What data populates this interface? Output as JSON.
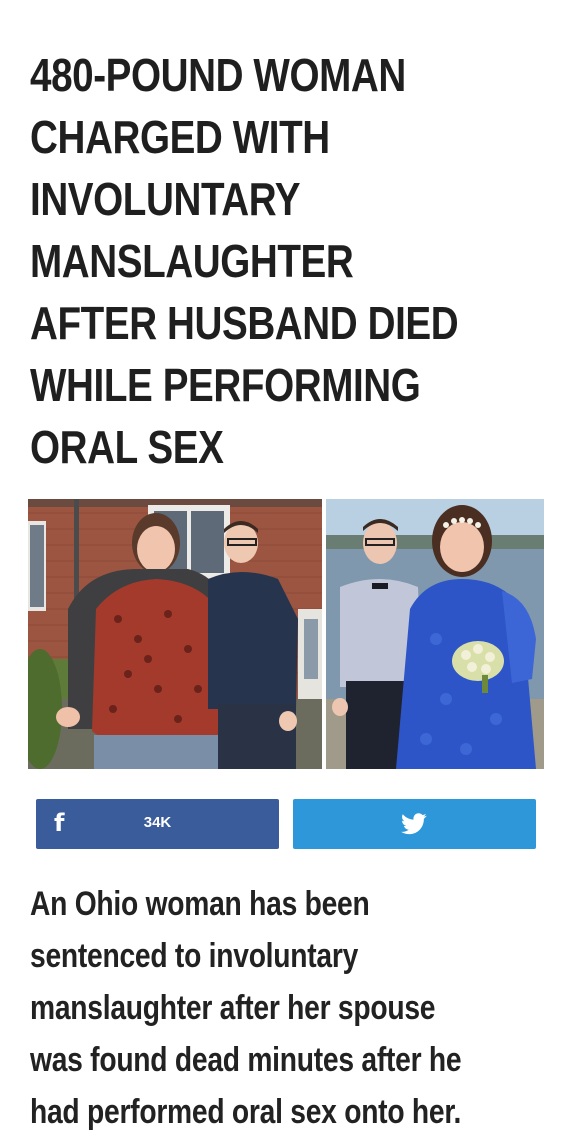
{
  "article": {
    "headline_lines": [
      "480-POUND WOMAN",
      "CHARGED WITH",
      "INVOLUNTARY",
      "MANSLAUGHTER",
      "AFTER HUSBAND DIED",
      "WHILE PERFORMING",
      "ORAL SEX"
    ],
    "body_lines": [
      "An Ohio woman has been",
      "sentenced to involuntary",
      "manslaughter after her spouse",
      "was found dead minutes after he",
      "had performed oral sex onto her."
    ]
  },
  "share": {
    "facebook": {
      "icon": "facebook-icon",
      "count": "34K",
      "color": "#3b5c9a"
    },
    "twitter": {
      "icon": "twitter-bird-icon",
      "color": "#2d97d9"
    }
  }
}
